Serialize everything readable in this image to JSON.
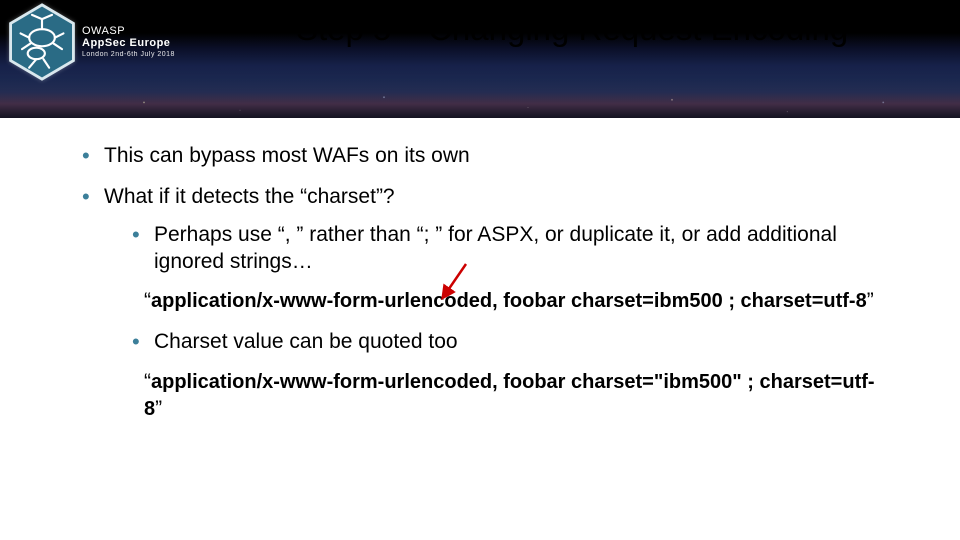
{
  "logo": {
    "org": "OWASP",
    "event": "AppSec Europe",
    "date": "London 2nd-6th July 2018"
  },
  "title": "Step 5 – Changing Request Encoding",
  "bullets": {
    "b1": "This can bypass most WAFs on its own",
    "b2": "What if it detects the “charset”?",
    "b2_sub1": "Perhaps use “, ” rather than “; ” for ASPX, or duplicate it, or add additional ignored strings…",
    "b2_sub2": "Charset value can be quoted too"
  },
  "code1": {
    "open_q": "“",
    "part1": "application/x-www-form-urlencoded, foobar charset=ibm500",
    "part2": " ; charset=utf-8",
    "close_q": "”"
  },
  "code2": {
    "open_q": "“",
    "part1": "application/x-www-form-urlencoded, foobar charset=\"ibm500\"",
    "part2": " ; charset=utf-8",
    "close_q": "”"
  }
}
